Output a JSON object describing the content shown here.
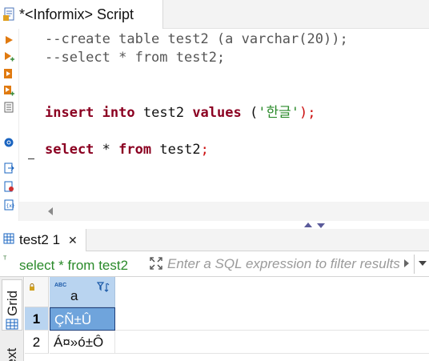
{
  "editor_tab": {
    "title": "*<Informix> Script"
  },
  "editor": {
    "lines": {
      "l1": "--create table test2 (a varchar(20));",
      "l2": "--select * from test2;",
      "l3": {
        "kw1": "insert",
        "kw2": "into",
        "table": "test2",
        "kw3": "values",
        "open": "(",
        "str": "'한글'",
        "close": ");"
      },
      "l4": {
        "kw1": "select",
        "star": "*",
        "kw2": "from",
        "table": "test2",
        "semi": ";"
      }
    }
  },
  "results_tab": {
    "label": "test2 1",
    "close": "✕"
  },
  "filter": {
    "prefix_icon": "ᵀ",
    "query_text": "select * from test2",
    "placeholder": "Enter a SQL expression to filter results"
  },
  "side_tabs": {
    "grid": "Grid",
    "text": "Text"
  },
  "grid": {
    "column": {
      "type_badge": "ABC",
      "name": "a"
    },
    "rows": [
      {
        "num": "1",
        "value": "ÇÑ±Û"
      },
      {
        "num": "2",
        "value": "Á¤»ó±Ô"
      }
    ]
  },
  "colors": {
    "selection": "#6fa4dc",
    "header": "#b9d4f0",
    "keyword": "#8b0021",
    "string": "#2a8a2a"
  }
}
